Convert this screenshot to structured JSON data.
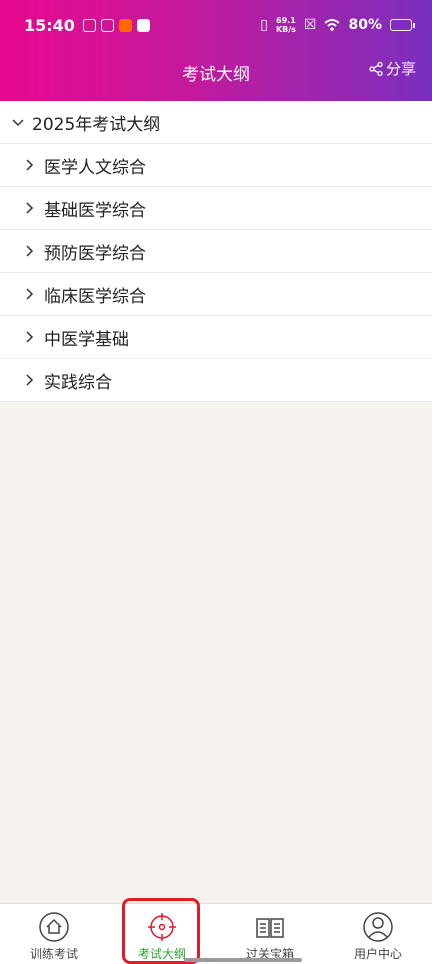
{
  "status_bar": {
    "time": "15:40",
    "net_speed_value": "69.1",
    "net_speed_unit": "KB/s",
    "battery": "80%"
  },
  "header": {
    "title": "考试大纲",
    "share_label": "分享"
  },
  "outline": {
    "group_label": "2025年考试大纲",
    "items": [
      {
        "label": "医学人文综合"
      },
      {
        "label": "基础医学综合"
      },
      {
        "label": "预防医学综合"
      },
      {
        "label": "临床医学综合"
      },
      {
        "label": "中医学基础"
      },
      {
        "label": "实践综合"
      }
    ]
  },
  "tabbar": {
    "tabs": [
      {
        "label": "训练考试",
        "icon": "home-icon"
      },
      {
        "label": "考试大纲",
        "icon": "target-icon",
        "active": true
      },
      {
        "label": "过关宝箱",
        "icon": "book-icon"
      },
      {
        "label": "用户中心",
        "icon": "user-icon"
      }
    ]
  },
  "colors": {
    "header_gradient_start": "#e8088f",
    "header_gradient_end": "#7a2fbf",
    "active_tab": "#29a329",
    "highlight": "#e21a2a"
  }
}
